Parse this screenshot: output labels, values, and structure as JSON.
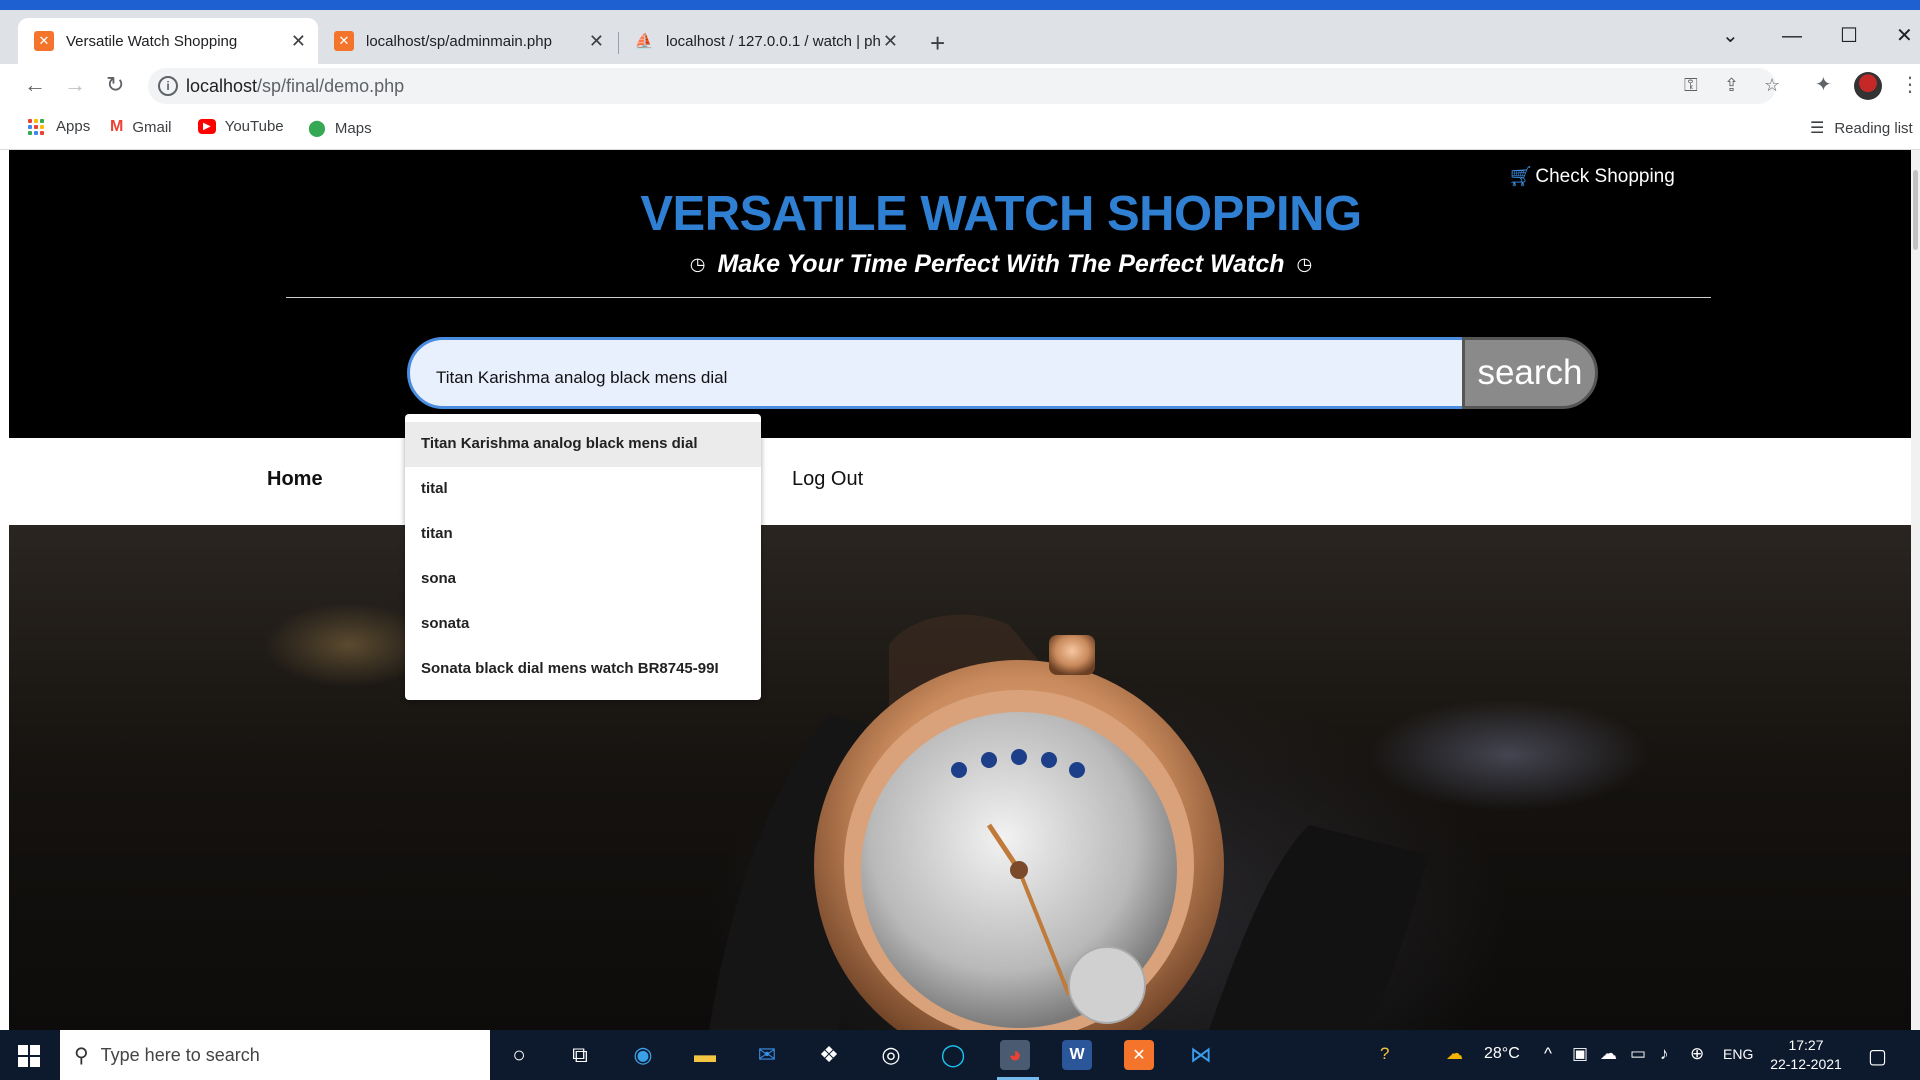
{
  "browser": {
    "tabs": [
      {
        "title": "Versatile Watch Shopping",
        "favicon": "xampp-icon",
        "active": true
      },
      {
        "title": "localhost/sp/adminmain.php",
        "favicon": "xampp-icon",
        "active": false
      },
      {
        "title": "localhost / 127.0.0.1 / watch | ph",
        "favicon": "phpmyadmin-icon",
        "active": false
      }
    ],
    "url_host": "localhost",
    "url_path": "/sp/final/demo.php",
    "bookmarks": [
      {
        "label": "Apps",
        "icon": "apps-grid-icon"
      },
      {
        "label": "Gmail",
        "icon": "gmail-icon"
      },
      {
        "label": "YouTube",
        "icon": "youtube-icon"
      },
      {
        "label": "Maps",
        "icon": "maps-icon"
      }
    ],
    "reading_list": "Reading list"
  },
  "site": {
    "cart_link": "Check Shopping",
    "title": "VERSATILE WATCH SHOPPING",
    "tagline": "Make Your Time Perfect With The Perfect Watch",
    "search_value": "Titan Karishma analog black mens dial",
    "search_button": "search",
    "nav": [
      "Home",
      "Log Out"
    ],
    "suggestions": [
      "Titan Karishma analog black mens dial",
      "tital",
      "titan",
      "sona",
      "sonata",
      "Sonata black dial mens watch BR8745-99I"
    ],
    "colors": {
      "title": "#2f7fd3",
      "search_bg": "#e8f0fe",
      "search_border": "#4a8de0"
    }
  },
  "taskbar": {
    "search_placeholder": "Type here to search",
    "temperature": "28°C",
    "language": "ENG",
    "time": "17:27",
    "date": "22-12-2021"
  }
}
